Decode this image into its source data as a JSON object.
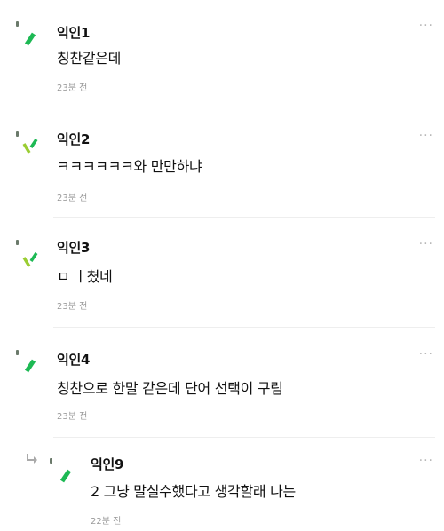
{
  "comments": [
    {
      "name": "익인1",
      "text": "칭찬같은데",
      "time": "23분 전",
      "more": "···",
      "avatar_icon": "single-slash-icon"
    },
    {
      "name": "익인2",
      "text": "ㅋㅋㅋㅋㅋㅋ와 만만하냐",
      "time": "23분 전",
      "more": "···",
      "avatar_icon": "double-slash-icon"
    },
    {
      "name": "익인3",
      "text": "ㅁ ㅣ쳤네",
      "time": "23분 전",
      "more": "···",
      "avatar_icon": "double-slash-icon"
    },
    {
      "name": "익인4",
      "text": "칭찬으로 한말 같은데 단어 선택이 구림",
      "time": "23분 전",
      "more": "···",
      "avatar_icon": "single-slash-icon"
    }
  ],
  "reply": {
    "name": "익인9",
    "text": "2 그냥 말실수했다고 생각할래 나는",
    "time": "22분 전",
    "more": "···",
    "avatar_icon": "single-slash-icon",
    "reply_icon": "reply-arrow-icon"
  },
  "colors": {
    "accent_green": "#1db954",
    "light_green": "#9acd32"
  }
}
